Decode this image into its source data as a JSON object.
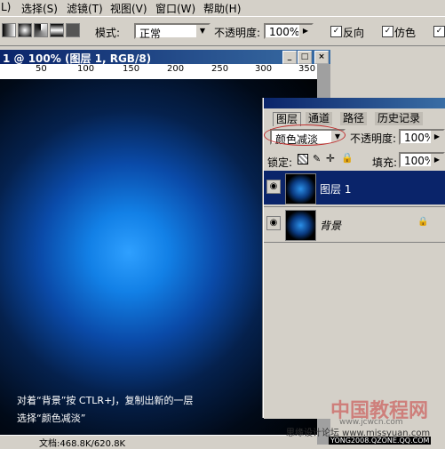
{
  "menu": [
    "L)",
    "选择(S)",
    "滤镜(T)",
    "视图(V)",
    "窗口(W)",
    "帮助(H)"
  ],
  "options": {
    "mode_label": "模式:",
    "mode_value": "正常",
    "opacity_label": "不透明度:",
    "opacity_value": "100%",
    "reverse_label": "反向",
    "dither_label": "仿色"
  },
  "document": {
    "title": "1 @ 100% (图层 1, RGB/8)",
    "ruler_ticks": [
      "50",
      "100",
      "150",
      "200",
      "250",
      "300",
      "350"
    ],
    "status": "文档:468.8K/620.8K"
  },
  "layers_panel": {
    "tabs": [
      "图层",
      "通道",
      "路径",
      "历史记录"
    ],
    "blend_mode": "颜色减淡",
    "opacity_label": "不透明度:",
    "opacity_value": "100%",
    "lock_label": "锁定:",
    "fill_label": "填充:",
    "fill_value": "100%",
    "layers": [
      {
        "name": "图层 1",
        "selected": true
      },
      {
        "name": "背景",
        "selected": false,
        "locked": true
      }
    ]
  },
  "captions": {
    "line1": "对着“背景”按 CTLR+J，复制出新的一层",
    "line2": "选择“颜色减淡”"
  },
  "watermarks": {
    "site_cn": "中国教程网",
    "site_url": "www.jcwcn.com",
    "forum": "思缘设计论坛 www.missyuan.com",
    "bottom": "YONG2008.QZONE.QQ.COM"
  }
}
